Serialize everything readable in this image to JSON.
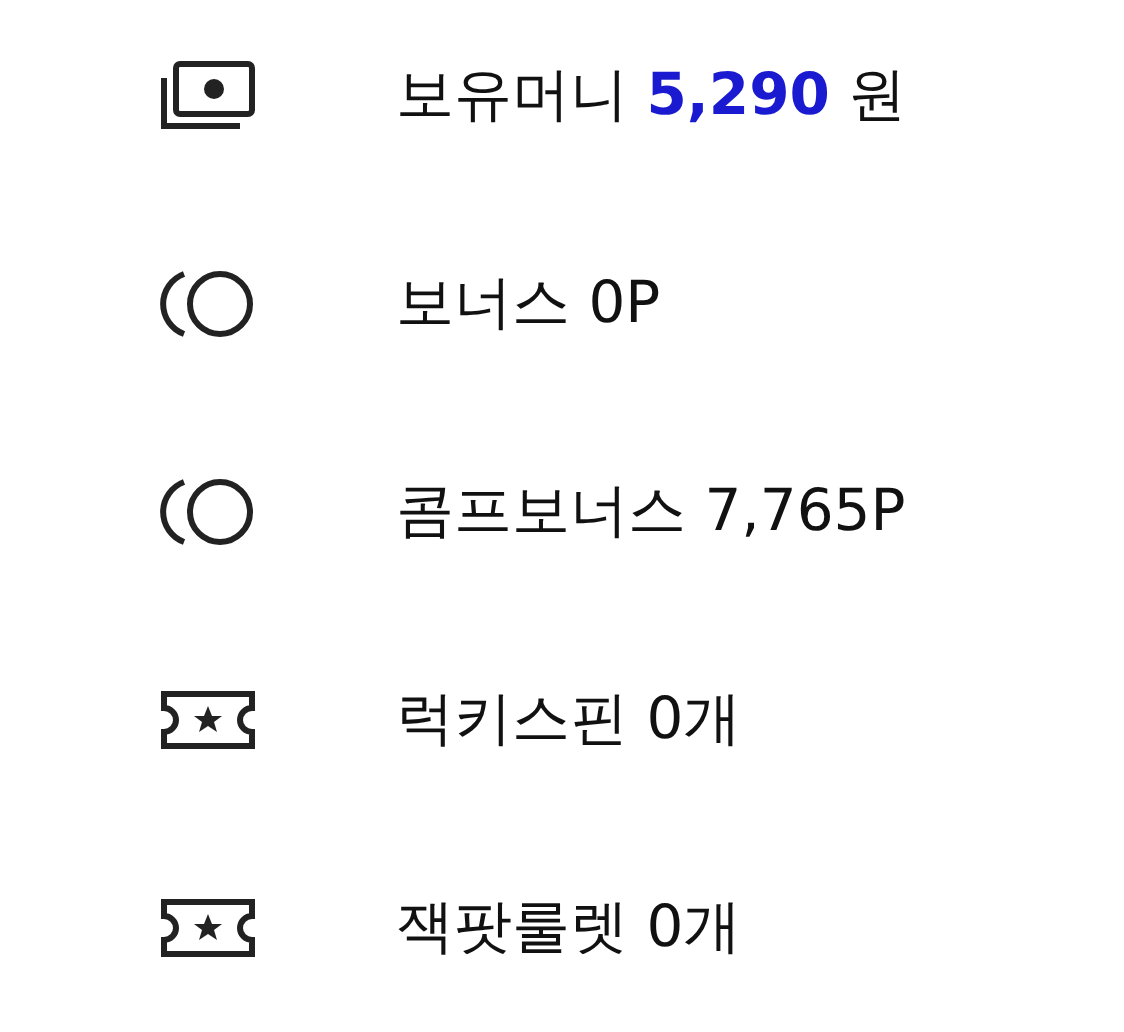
{
  "items": [
    {
      "kind": "money",
      "text": "보유머니 **5,290** 원"
    },
    {
      "kind": "coin",
      "text": "보너스 0P"
    },
    {
      "kind": "coin",
      "text": "콤프보너스 7,765P"
    },
    {
      "kind": "ticket",
      "text": "럭키스핀 0개"
    },
    {
      "kind": "ticket",
      "text": "잭팟룰렛 0개"
    }
  ]
}
